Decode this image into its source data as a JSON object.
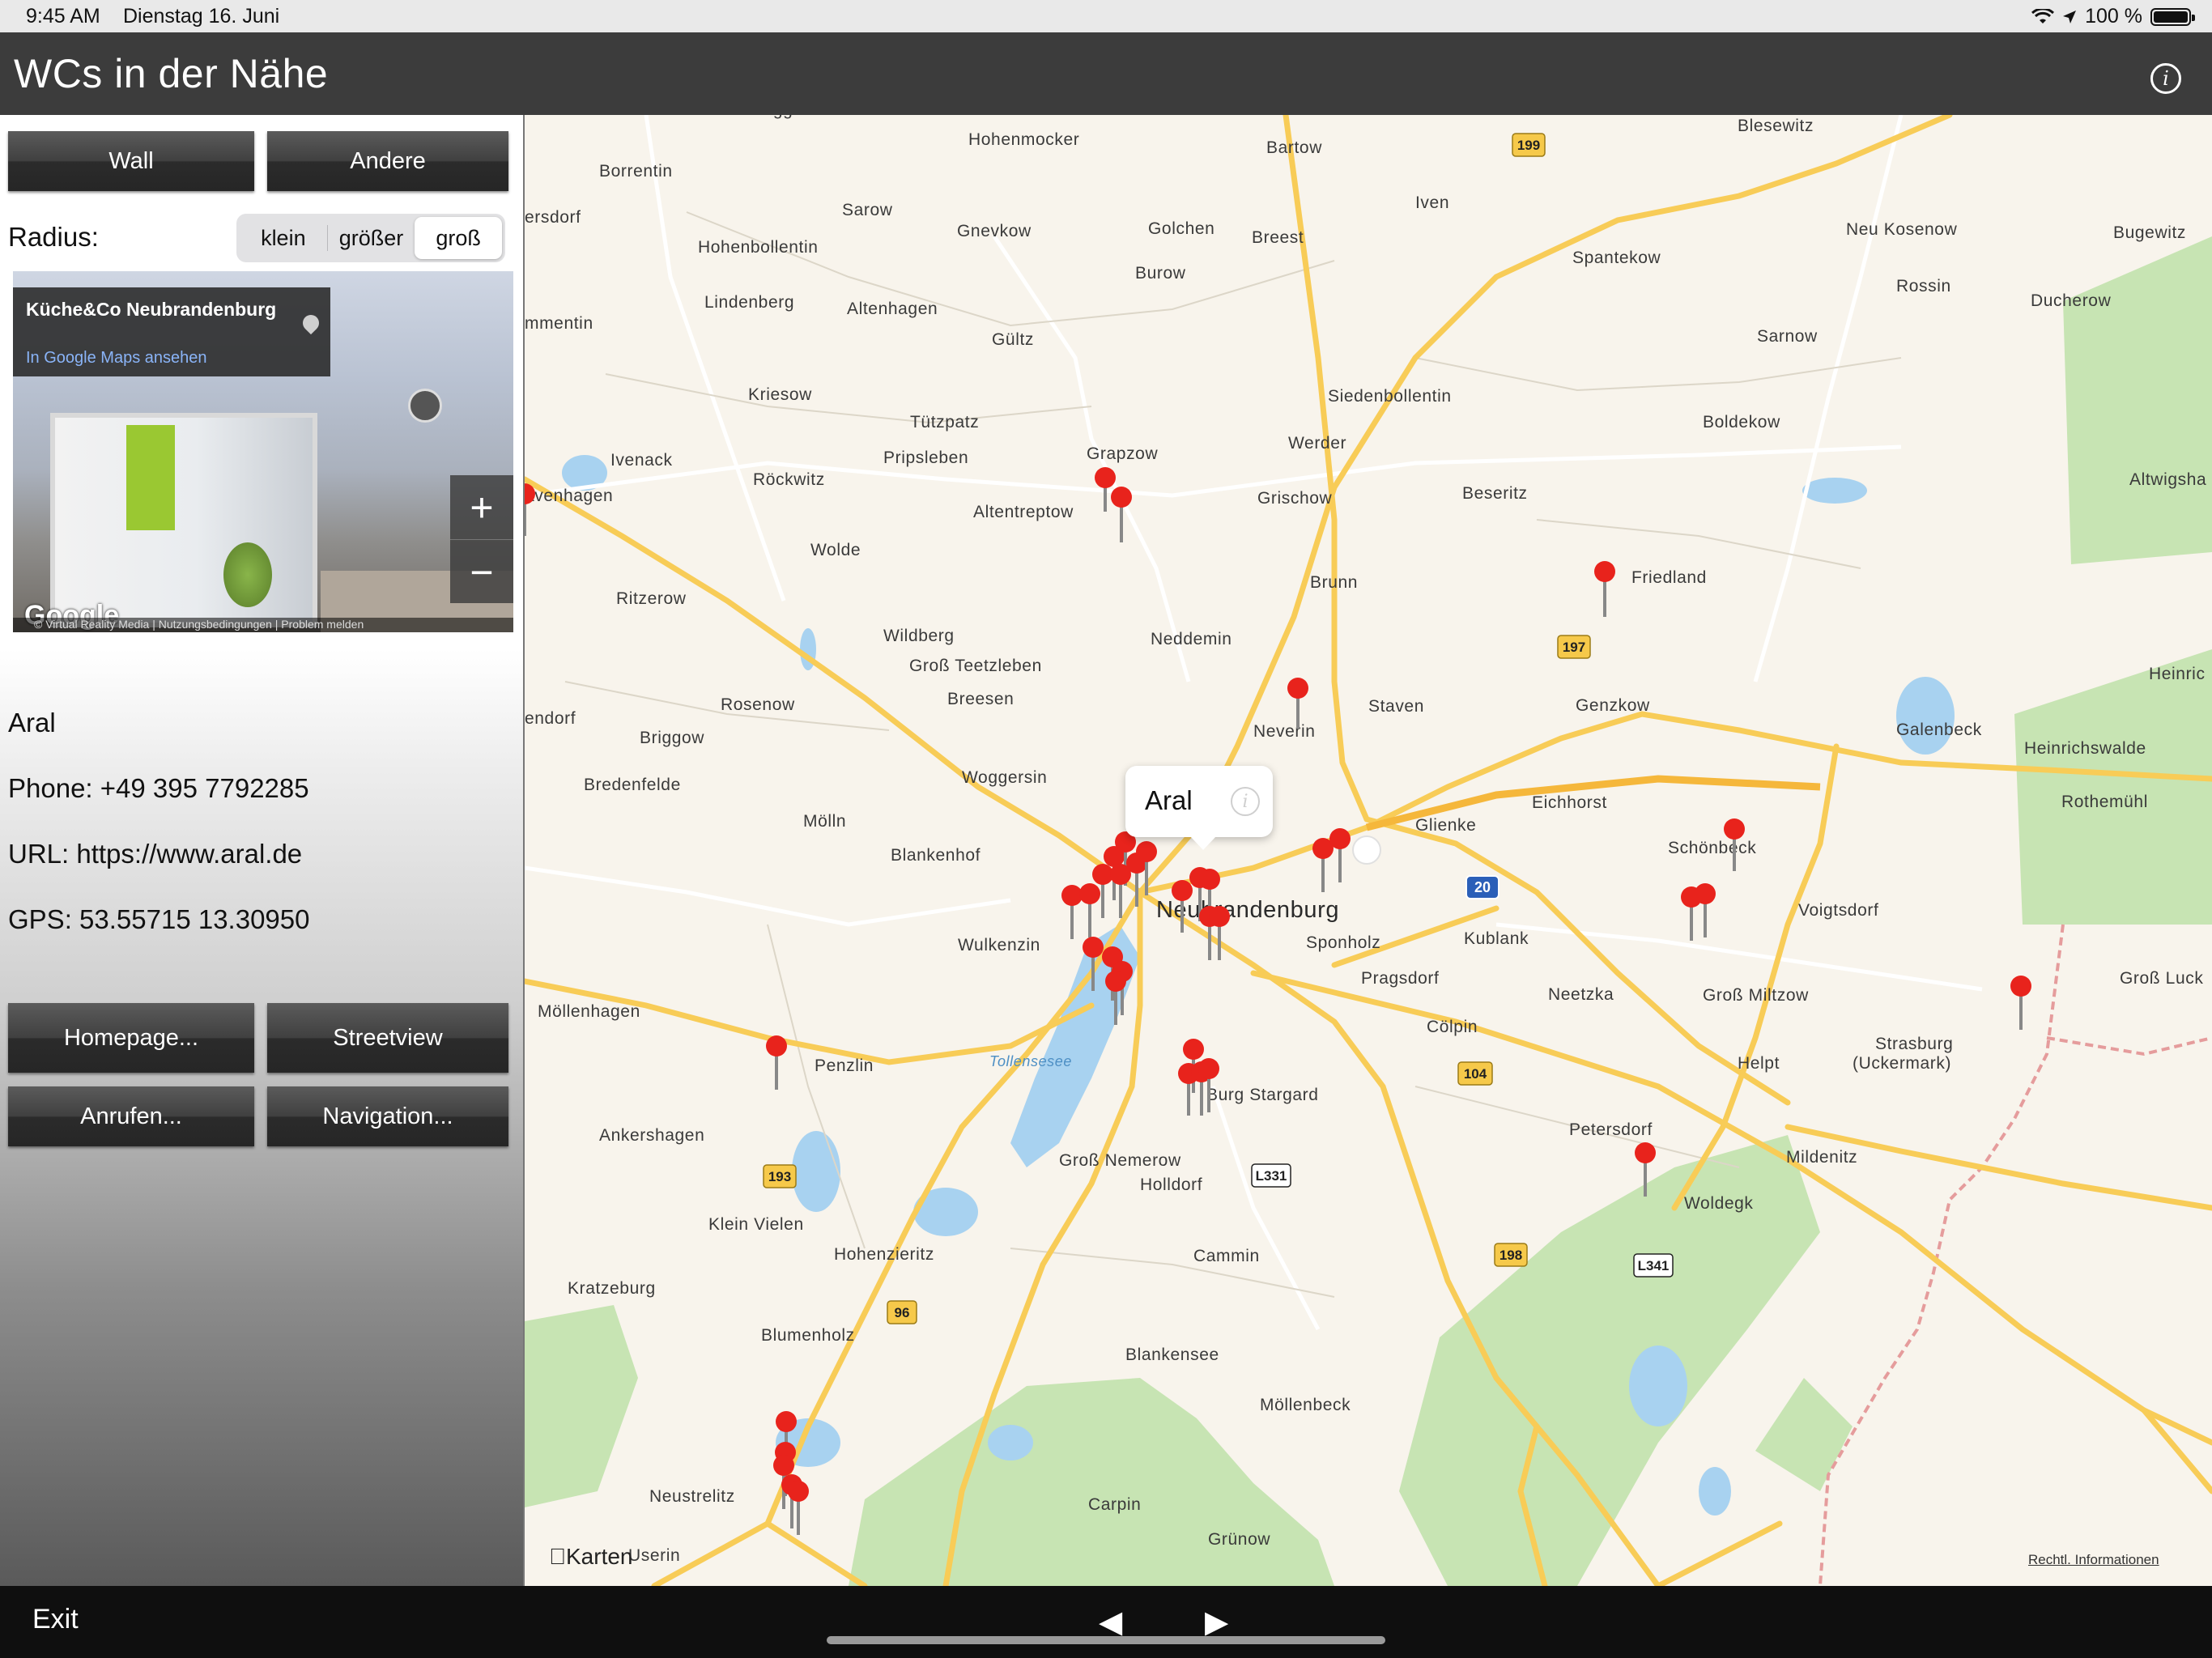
{
  "status_bar": {
    "time": "9:45 AM",
    "date": "Dienstag 16. Juni",
    "battery": "100 %",
    "icons": [
      "wifi-icon",
      "location-arrow-icon",
      "battery-icon"
    ]
  },
  "navbar": {
    "title": "WCs in der Nähe",
    "info_icon": "info-icon"
  },
  "filters": {
    "wall": "Wall",
    "andere": "Andere"
  },
  "radius": {
    "label": "Radius:",
    "options": [
      "klein",
      "größer",
      "groß"
    ],
    "selected": "groß"
  },
  "streetview": {
    "place_name": "Küche&Co Neubrandenburg",
    "maps_link": "In Google Maps ansehen",
    "zoom_in": "+",
    "zoom_out": "−",
    "brand": "Google",
    "footer": "© Virtual Reality Media   |   Nutzungsbedingungen   |   Problem melden"
  },
  "details": {
    "name": "Aral",
    "phone": "Phone: +49 395 7792285",
    "url": "URL: https://www.aral.de",
    "gps": "GPS: 53.55715 13.30950"
  },
  "actions": {
    "homepage": "Homepage...",
    "streetview": "Streetview",
    "call": "Anrufen...",
    "navigation": "Navigation..."
  },
  "map": {
    "callout_title": "Aral",
    "brand": "Karten",
    "legal": "Rechtl. Informationen",
    "city": "Neubrandenburg",
    "lake": "Tollensesee",
    "places": [
      "Beggerow",
      "Hohenmocker",
      "Bartow",
      "Blesewitz",
      "Borrentin",
      "ersdorf",
      "Sarow",
      "Gnevkow",
      "Golchen",
      "Breest",
      "Iven",
      "Neu Kosenow",
      "Bugewitz",
      "Hohenbollentin",
      "Spantekow",
      "Burow",
      "Rossin",
      "Ducherow",
      "Lindenberg",
      "Altenhagen",
      "Gültz",
      "Sarnow",
      "mmentin",
      "Kriesow",
      "Siedenbollentin",
      "Tützpatz",
      "Boldekow",
      "Ivenack",
      "Röckwitz",
      "Pripsleben",
      "Grapzow",
      "Werder",
      "Grischow",
      "Beseritz",
      "Altwigsha",
      "avenhagen",
      "Altentreptow",
      "Wolde",
      "Friedland",
      "Brunn",
      "Ritzerow",
      "Wildberg",
      "Neddemin",
      "Groß Teetzleben",
      "Heinric",
      "Rosenow",
      "Breesen",
      "Staven",
      "Genzkow",
      "endorf",
      "Briggow",
      "Neverin",
      "Galenbeck",
      "Heinrichswalde",
      "Bredenfelde",
      "Woggersin",
      "Glienke",
      "Eichhorst",
      "Rothemühl",
      "Mölln",
      "Schönbeck",
      "Blankenhof",
      "Voigtsdorf",
      "Kublank",
      "Wulkenzin",
      "Sponholz",
      "Pragsdorf",
      "Neetzka",
      "Groß Miltzow",
      "Groß Luck",
      "Möllenhagen",
      "Cölpin",
      "Strasburg",
      "(Uckermark)",
      "Penzlin",
      "Helpt",
      "Burg Stargard",
      "Ankershagen",
      "Petersdorf",
      "Mildenitz",
      "Groß Nemerow",
      "Holldorf",
      "Woldegk",
      "Klein Vielen",
      "Hohenzieritz",
      "Cammin",
      "Kratzeburg",
      "Blumenholz",
      "Blankensee",
      "Möllenbeck",
      "Neustrelitz",
      "Carpin",
      "Grünow",
      "Userin"
    ],
    "shields": [
      "199",
      "197",
      "20",
      "104",
      "193",
      "198",
      "L341",
      "L331",
      "96"
    ]
  },
  "bottom_bar": {
    "exit": "Exit",
    "prev": "◀",
    "next": "▶"
  }
}
